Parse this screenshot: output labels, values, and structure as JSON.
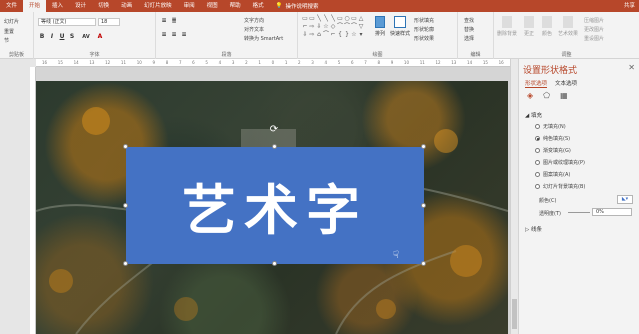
{
  "tabs": [
    {
      "label": "文件",
      "active": false
    },
    {
      "label": "开始",
      "active": true
    },
    {
      "label": "插入",
      "active": false
    },
    {
      "label": "设计",
      "active": false
    },
    {
      "label": "切换",
      "active": false
    },
    {
      "label": "动画",
      "active": false
    },
    {
      "label": "幻灯片放映",
      "active": false
    },
    {
      "label": "审阅",
      "active": false
    },
    {
      "label": "视图",
      "active": false
    },
    {
      "label": "帮助",
      "active": false
    },
    {
      "label": "格式",
      "active": false
    }
  ],
  "tell_me": "操作说明搜索",
  "share": "共享",
  "ribbon": {
    "clipboard": {
      "label": "剪贴板",
      "new_slide": "幻灯片",
      "reset": "重置",
      "section": "节"
    },
    "font": {
      "label": "字体",
      "font_name": "等线 (正文)",
      "font_size": "18",
      "bold": "B",
      "italic": "I",
      "underline": "U",
      "strike": "S",
      "char_spacing": "AV"
    },
    "paragraph": {
      "label": "段落",
      "text_direction": "文字方向",
      "align_text": "对齐文本",
      "smartart": "转换为 SmartArt"
    },
    "drawing": {
      "label": "绘图",
      "arrange": "排列",
      "quick_styles": "快速样式",
      "fill": "形状填充",
      "outline": "形状轮廓",
      "effects": "形状效果"
    },
    "editing": {
      "label": "编辑",
      "find": "查找",
      "replace": "替换",
      "select": "选择"
    },
    "adjust": {
      "label": "调整",
      "remove_bg": "删除背景",
      "corrections": "更正",
      "color": "颜色",
      "artistic": "艺术效果",
      "compress": "压缩图片",
      "change": "更改图片",
      "reset_pic": "重设图片"
    }
  },
  "ruler_ticks": [
    "16",
    "15",
    "14",
    "13",
    "12",
    "11",
    "10",
    "9",
    "8",
    "7",
    "6",
    "5",
    "4",
    "3",
    "2",
    "1",
    "0",
    "1",
    "2",
    "3",
    "4",
    "5",
    "6",
    "7",
    "8",
    "9",
    "10",
    "11",
    "12",
    "13",
    "14",
    "15",
    "16"
  ],
  "slide": {
    "wordart_text": "艺术字"
  },
  "pane": {
    "title": "设置形状格式",
    "tabs": [
      "形状选项",
      "文本选项"
    ],
    "fill_section": "填充",
    "fill_options": [
      {
        "label": "无填充(N)",
        "checked": false
      },
      {
        "label": "纯色填充(S)",
        "checked": true
      },
      {
        "label": "渐变填充(G)",
        "checked": false
      },
      {
        "label": "图片或纹理填充(P)",
        "checked": false
      },
      {
        "label": "图案填充(A)",
        "checked": false
      },
      {
        "label": "幻灯片背景填充(B)",
        "checked": false
      }
    ],
    "color_label": "颜色(C)",
    "transparency_label": "透明度(T)",
    "transparency_value": "0%",
    "line_section": "线条"
  },
  "colors": {
    "accent": "#b7472a",
    "textbox_fill": "#4472c4"
  }
}
